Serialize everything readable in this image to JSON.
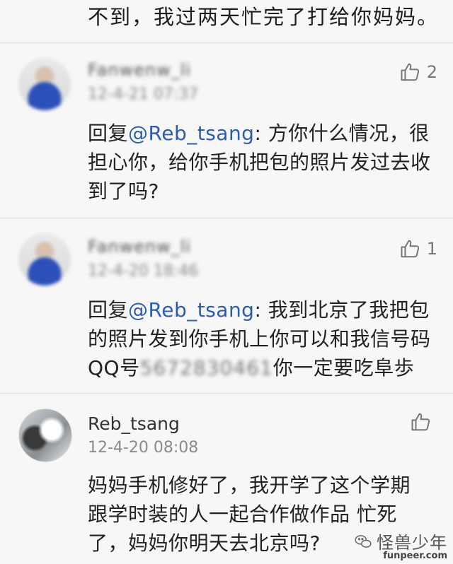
{
  "top_text": "不到，我过两天忙完了打给你妈妈。",
  "comments": [
    {
      "name": "Fanwenw_li",
      "date": "12-4-21 07:37",
      "likes": "2",
      "prefix": "回复",
      "mention": "@Reb_tsang",
      "text": ": 方你什么情况，很担心你，给你手机把包的照片发过去收到了吗?"
    },
    {
      "name": "Fanwenw_li",
      "date": "12-4-20 18:46",
      "likes": "1",
      "prefix": "回复",
      "mention": "@Reb_tsang",
      "text_before": ": 我到北京了我把包的照片发到你手机上你可以和我信号码QQ号",
      "blurred": "5672830461",
      "text_after": "你一定要吃阜歩"
    },
    {
      "name": "Reb_tsang",
      "date": "12-4-20 08:08",
      "likes": "",
      "text": "妈妈手机修好了，我开学了这个学期跟学时装的人一起合作做作品 忙死了，妈妈你明天去北京吗?"
    }
  ],
  "watermark": "怪兽少年",
  "site": "funpeer.com"
}
